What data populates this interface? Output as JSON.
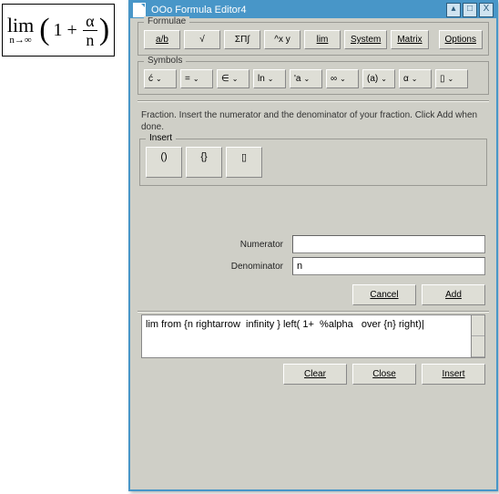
{
  "preview": {
    "lim": "lim",
    "sub": "n→∞",
    "lparen": "(",
    "oneplus": "1 +",
    "alpha": "α",
    "denom": "n",
    "rparen": ")"
  },
  "window": {
    "title": "OOo Formula Editor4",
    "min": "▴",
    "max": "□",
    "close": "X"
  },
  "formulae": {
    "legend": "Formulae",
    "ab": "a/b",
    "sqrt": "√",
    "sum": "ΣΠ∫",
    "pow": "^x y",
    "lim": "lim",
    "system": "System",
    "matrix": "Matrix",
    "options": "Options"
  },
  "symbols": {
    "legend": "Symbols",
    "items": [
      "ć",
      "=",
      "∈",
      "ln",
      "'a",
      "∞",
      "(a)",
      "α",
      "▯"
    ]
  },
  "instruction": "Fraction. Insert the numerator and the denominator of your fraction. Click Add when done.",
  "insert": {
    "legend": "Insert",
    "paren": "()",
    "brace": "{}",
    "box": "▯"
  },
  "fields": {
    "numerator_label": "Numerator",
    "numerator_value": "",
    "denominator_label": "Denominator",
    "denominator_value": "n"
  },
  "buttons": {
    "cancel": "Cancel",
    "add": "Add",
    "clear": "Clear",
    "close": "Close",
    "insert": "Insert"
  },
  "code": "lim from {n rightarrow  infinity } left( 1+  %alpha   over {n} right)|"
}
